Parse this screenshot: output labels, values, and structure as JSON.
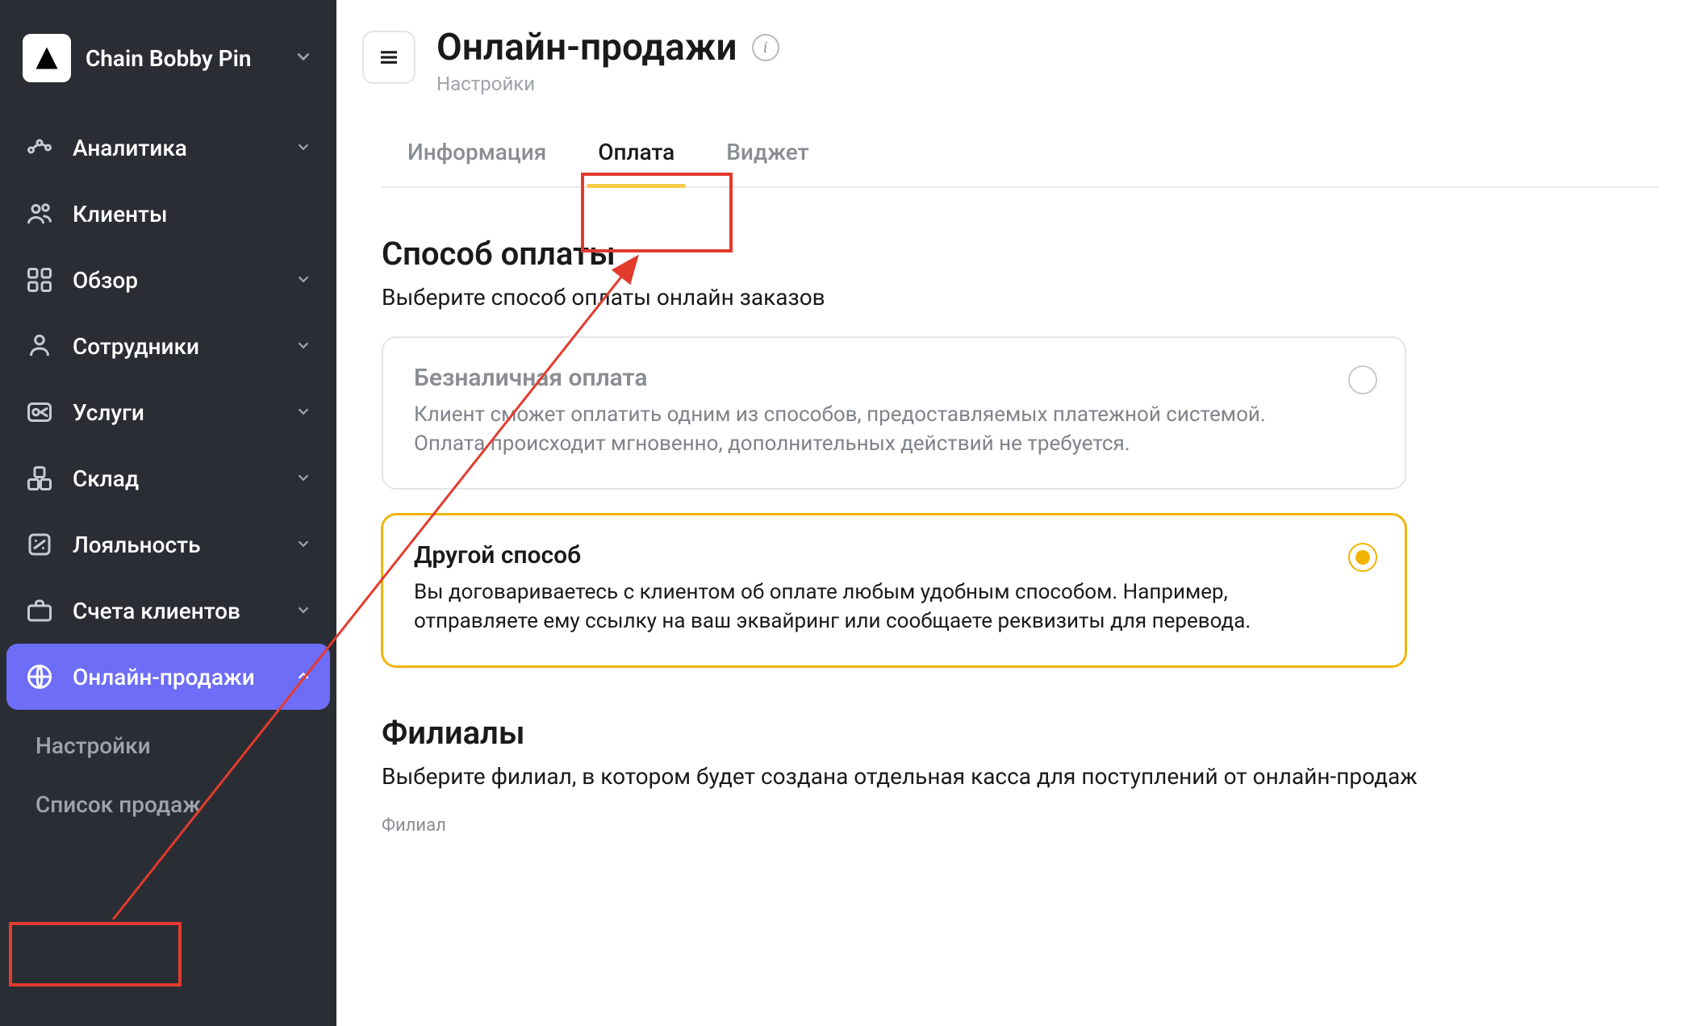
{
  "company": {
    "name": "Chain Bobby Pin"
  },
  "sidebar": {
    "items": [
      {
        "label": "Аналитика",
        "expandable": true
      },
      {
        "label": "Клиенты",
        "expandable": false
      },
      {
        "label": "Обзор",
        "expandable": true
      },
      {
        "label": "Сотрудники",
        "expandable": true
      },
      {
        "label": "Услуги",
        "expandable": true
      },
      {
        "label": "Склад",
        "expandable": true
      },
      {
        "label": "Лояльность",
        "expandable": true
      },
      {
        "label": "Счета клиентов",
        "expandable": true
      },
      {
        "label": "Онлайн-продажи",
        "expandable": true,
        "active": true
      }
    ],
    "sub": [
      {
        "label": "Настройки"
      },
      {
        "label": "Список продаж"
      }
    ]
  },
  "header": {
    "title": "Онлайн-продажи",
    "subtitle": "Настройки"
  },
  "tabs": [
    {
      "label": "Информация"
    },
    {
      "label": "Оплата",
      "active": true
    },
    {
      "label": "Виджет"
    }
  ],
  "payment": {
    "title": "Способ оплаты",
    "desc": "Выберите способ оплаты онлайн заказов",
    "options": [
      {
        "title": "Безналичная оплата",
        "desc": "Клиент сможет оплатить одним из способов, предоставляемых платежной системой. Оплата происходит мгновенно, дополнительных действий не требуется."
      },
      {
        "title": "Другой способ",
        "desc": "Вы договариваетесь с клиентом об оплате любым удобным способом. Например, отправляете ему ссылку на ваш эквайринг или сообщаете реквизиты для перевода.",
        "selected": true
      }
    ]
  },
  "branches": {
    "title": "Филиалы",
    "desc": "Выберите филиал, в котором будет создана отдельная касса для поступлений от онлайн-продаж",
    "field_label": "Филиал"
  }
}
